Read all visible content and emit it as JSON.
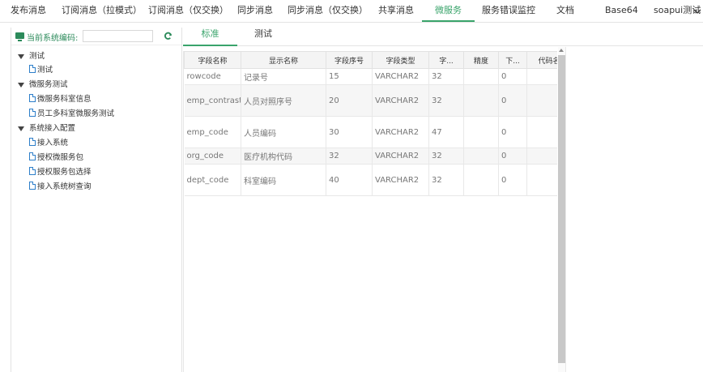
{
  "topnav": {
    "tabs": [
      {
        "label": "发布消息",
        "name": "tab-publish"
      },
      {
        "label": "订阅消息（拉模式）",
        "name": "tab-subscribe-pull"
      },
      {
        "label": "订阅消息（仅交换）",
        "name": "tab-subscribe-exchange"
      },
      {
        "label": "同步消息",
        "name": "tab-sync"
      },
      {
        "label": "同步消息（仅交换）",
        "name": "tab-sync-exchange"
      },
      {
        "label": "共享消息",
        "name": "tab-share"
      },
      {
        "label": "微服务",
        "name": "tab-microservice"
      },
      {
        "label": "服务错误监控",
        "name": "tab-error-monitor"
      },
      {
        "label": "文档",
        "name": "tab-docs"
      },
      {
        "label": "Base64",
        "name": "tab-base64"
      },
      {
        "label": "soapui测试",
        "name": "tab-soapui"
      }
    ],
    "active": "微服务",
    "more_icon": "chevron-down-icon"
  },
  "sidebar": {
    "system_code_label": "当前系统编码:",
    "system_code_value": "",
    "refresh_icon": "refresh-icon",
    "tree": [
      {
        "label": "测试",
        "type": "folder"
      },
      {
        "label": "测试",
        "type": "file"
      },
      {
        "label": "微服务测试",
        "type": "folder"
      },
      {
        "label": "微服务科室信息",
        "type": "file"
      },
      {
        "label": "员工多科室微服务测试",
        "type": "file"
      },
      {
        "label": "系统接入配置",
        "type": "folder"
      },
      {
        "label": "接入系统",
        "type": "file"
      },
      {
        "label": "授权微服务包",
        "type": "file"
      },
      {
        "label": "授权服务包选择",
        "type": "file"
      },
      {
        "label": "接入系统树查询",
        "type": "file"
      }
    ]
  },
  "content": {
    "subtabs": [
      "标准",
      "测试"
    ],
    "active_subtab": "标准",
    "table": {
      "headers": [
        "字段名称",
        "显示名称",
        "字段序号",
        "字段类型",
        "字...",
        "精度",
        "下...",
        "代码名"
      ],
      "rows": [
        [
          "rowcode",
          "记录号",
          "15",
          "VARCHAR2",
          "32",
          "",
          "0",
          ""
        ],
        [
          "emp_contrast",
          "人员对照序号",
          "20",
          "VARCHAR2",
          "32",
          "",
          "0",
          ""
        ],
        [
          "emp_code",
          "人员编码",
          "30",
          "VARCHAR2",
          "47",
          "",
          "0",
          ""
        ],
        [
          "org_code",
          "医疗机构代码",
          "32",
          "VARCHAR2",
          "32",
          "",
          "0",
          ""
        ],
        [
          "dept_code",
          "科室编码",
          "40",
          "VARCHAR2",
          "32",
          "",
          "0",
          ""
        ]
      ]
    }
  },
  "colors": {
    "accent": "#3aa46b",
    "tree_icon": "#2d7ec9"
  }
}
